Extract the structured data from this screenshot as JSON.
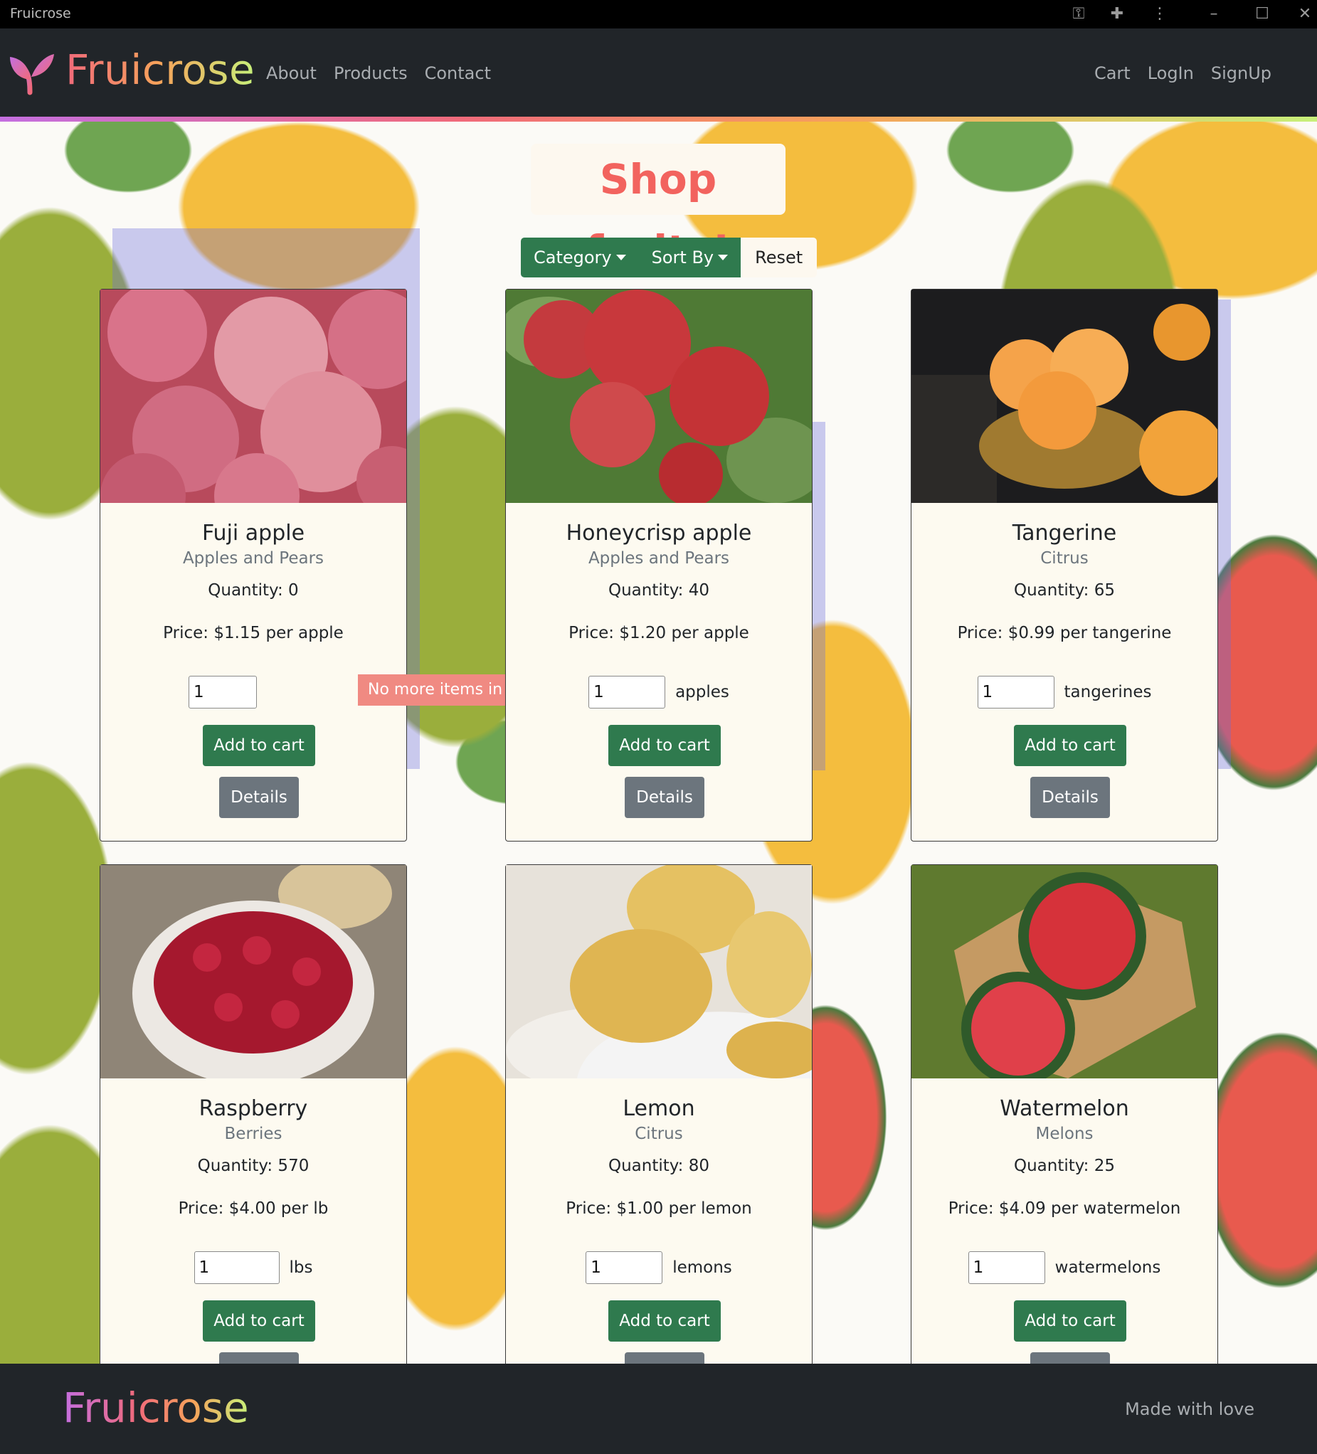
{
  "window": {
    "title": "Fruicrose"
  },
  "navbar": {
    "brand": "Fruicrose",
    "links_left": [
      "About",
      "Products",
      "Contact"
    ],
    "links_right": [
      "Cart",
      "LogIn",
      "SignUp"
    ]
  },
  "main": {
    "heading": "Shop fruits!",
    "controls": {
      "category": "Category",
      "sort_by": "Sort By",
      "reset": "Reset"
    }
  },
  "products": [
    {
      "name": "Fuji apple",
      "category": "Apples and Pears",
      "quantity": "Quantity: 0",
      "price": "Price: $1.15 per apple",
      "input_value": "1",
      "unit": "",
      "alert": "No more items in stock!",
      "add_label": "Add to cart",
      "details_label": "Details"
    },
    {
      "name": "Honeycrisp apple",
      "category": "Apples and Pears",
      "quantity": "Quantity: 40",
      "price": "Price: $1.20 per apple",
      "input_value": "1",
      "unit": "apples",
      "add_label": "Add to cart",
      "details_label": "Details"
    },
    {
      "name": "Tangerine",
      "category": "Citrus",
      "quantity": "Quantity: 65",
      "price": "Price: $0.99 per tangerine",
      "input_value": "1",
      "unit": "tangerines",
      "add_label": "Add to cart",
      "details_label": "Details"
    },
    {
      "name": "Raspberry",
      "category": "Berries",
      "quantity": "Quantity: 570",
      "price": "Price: $4.00 per lb",
      "input_value": "1",
      "unit": "lbs",
      "add_label": "Add to cart",
      "details_label": ""
    },
    {
      "name": "Lemon",
      "category": "Citrus",
      "quantity": "Quantity: 80",
      "price": "Price: $1.00 per lemon",
      "input_value": "1",
      "unit": "lemons",
      "add_label": "Add to cart",
      "details_label": ""
    },
    {
      "name": "Watermelon",
      "category": "Melons",
      "quantity": "Quantity: 25",
      "price": "Price: $4.09 per watermelon",
      "input_value": "1",
      "unit": "watermelons",
      "add_label": "Add to cart",
      "details_label": ""
    }
  ],
  "footer": {
    "brand": "Fruicrose",
    "text": "Made with love"
  },
  "colors": {
    "primary_green": "#2f7a4e",
    "heading_red": "#f2635e",
    "navbar_bg": "#212529",
    "alert_bg": "#f08a82"
  }
}
